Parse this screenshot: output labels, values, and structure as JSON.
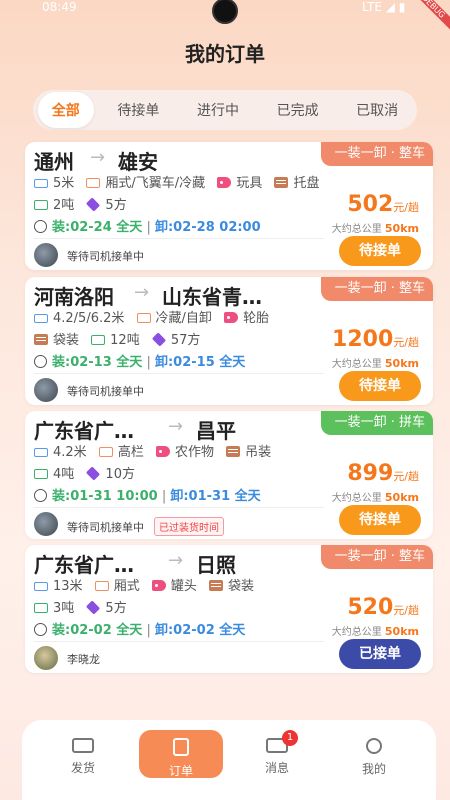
{
  "status": {
    "time": "08:49",
    "network": "LTE ◢ ▮",
    "debug_label": "DEBUG"
  },
  "title": "我的订单",
  "tabs": [
    "全部",
    "待接单",
    "进行中",
    "已完成",
    "已取消"
  ],
  "orders": [
    {
      "from": "通州",
      "to": "雄安",
      "badge": "一装一卸 · 整车",
      "badge_color": "#f08a6a",
      "attrs_row1": [
        "5米",
        "厢式/飞翼车/冷藏",
        "玩具",
        "托盘"
      ],
      "attrs_row2": [
        "2吨",
        "5方"
      ],
      "load": "装:02-24 全天",
      "unload": "卸:02-28 02:00",
      "price": "502",
      "price_unit": "元/趟",
      "dist_label": "大约总公里",
      "dist": "50km",
      "driver": "等待司机接单中",
      "overdue": "",
      "button": "待接单"
    },
    {
      "from": "河南洛阳",
      "to": "山东省青…",
      "badge": "一装一卸 · 整车",
      "badge_color": "#f08a6a",
      "attrs_row1": [
        "4.2/5/6.2米",
        "冷藏/自卸",
        "轮胎"
      ],
      "attrs_row2": [
        "袋装",
        "12吨",
        "57方"
      ],
      "load": "装:02-13 全天",
      "unload": "卸:02-15 全天",
      "price": "1200",
      "price_unit": "元/趟",
      "dist_label": "大约总公里",
      "dist": "50km",
      "driver": "等待司机接单中",
      "overdue": "",
      "button": "待接单"
    },
    {
      "from": "广东省广…",
      "to": "昌平",
      "badge": "一装一卸 · 拼车",
      "badge_color": "#5cc05c",
      "attrs_row1": [
        "4.2米",
        "高栏",
        "农作物",
        "吊装"
      ],
      "attrs_row2": [
        "4吨",
        "10方"
      ],
      "load": "装:01-31 10:00",
      "unload": "卸:01-31 全天",
      "price": "899",
      "price_unit": "元/趟",
      "dist_label": "大约总公里",
      "dist": "50km",
      "driver": "等待司机接单中",
      "overdue": "已过装货时间",
      "button": "待接单"
    },
    {
      "from": "广东省广…",
      "to": "日照",
      "badge": "一装一卸 · 整车",
      "badge_color": "#f08a6a",
      "attrs_row1": [
        "13米",
        "厢式",
        "罐头",
        "袋装"
      ],
      "attrs_row2": [
        "3吨",
        "5方"
      ],
      "load": "装:02-02 全天",
      "unload": "卸:02-02 全天",
      "price": "520",
      "price_unit": "元/趟",
      "dist_label": "大约总公里",
      "dist": "50km",
      "driver": "李晓龙",
      "overdue": "",
      "button": "已接单"
    }
  ],
  "nav": [
    {
      "label": "发货",
      "icon": "truck-icon"
    },
    {
      "label": "订单",
      "icon": "order-icon"
    },
    {
      "label": "消息",
      "icon": "mail-icon"
    },
    {
      "label": "我的",
      "icon": "user-icon"
    }
  ],
  "notif_count": "1"
}
